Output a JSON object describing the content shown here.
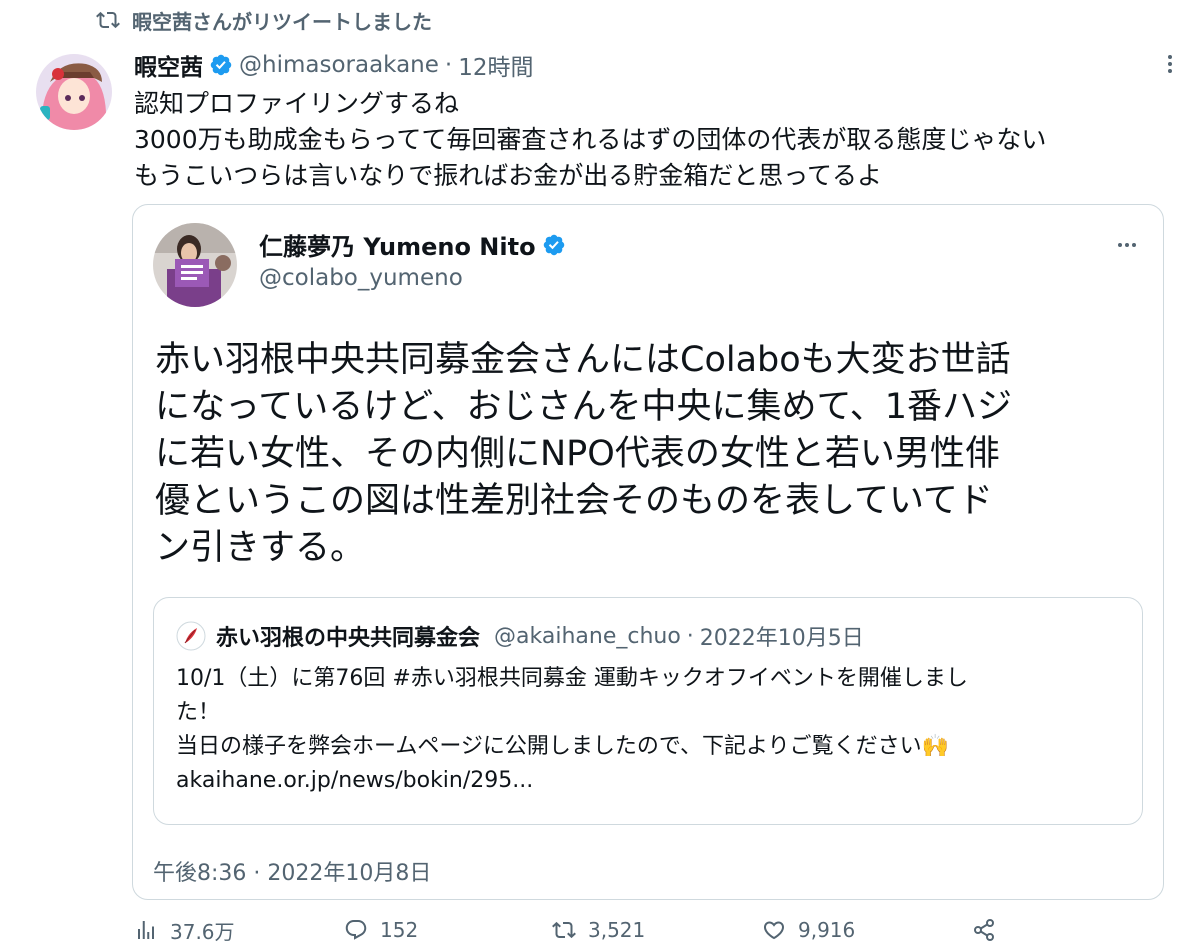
{
  "retweet_banner": {
    "text": "暇空茜さんがリツイートしました",
    "icon": "retweet-icon"
  },
  "tweet": {
    "author_name": "暇空茜",
    "handle": "@himasoraakane",
    "separator": "·",
    "time": "12時間",
    "lines": [
      "認知プロファイリングするね",
      "3000万も助成金もらってて毎回審査されるはずの団体の代表が取る態度じゃない",
      "もうこいつらは言いなりで振ればお金が出る貯金箱だと思ってるよ"
    ]
  },
  "quoted_tweet": {
    "author_name": "仁藤夢乃 Yumeno Nito",
    "handle": "@colabo_yumeno",
    "lines": [
      "赤い羽根中央共同募金会さんにはColaboも大変お世話",
      "になっているけど、おじさんを中央に集めて、1番ハジ",
      "に若い女性、その内側にNPO代表の女性と若い男性俳",
      "優というこの図は性差別社会そのものを表していてド",
      "ン引きする。"
    ],
    "timestamp": "午後8:36 · 2022年10月8日",
    "inner_quote": {
      "author_name": "赤い羽根の中央共同募金会",
      "handle": "@akaihane_chuo",
      "separator": "·",
      "date": "2022年10月5日",
      "lines": [
        "10/1（土）に第76回 #赤い羽根共同募金 運動キックオフイベントを開催しまし",
        "た！",
        "当日の様子を弊会ホームページに公開しましたので、下記よりご覧ください🙌",
        "akaihane.or.jp/news/bokin/295..."
      ]
    }
  },
  "actions": {
    "views": "37.6万",
    "replies": "152",
    "retweets": "3,521",
    "likes": "9,916"
  },
  "colors": {
    "text": "#0f1419",
    "secondary": "#536471",
    "border": "#cfd9de",
    "verified": "#1d9bf0"
  }
}
